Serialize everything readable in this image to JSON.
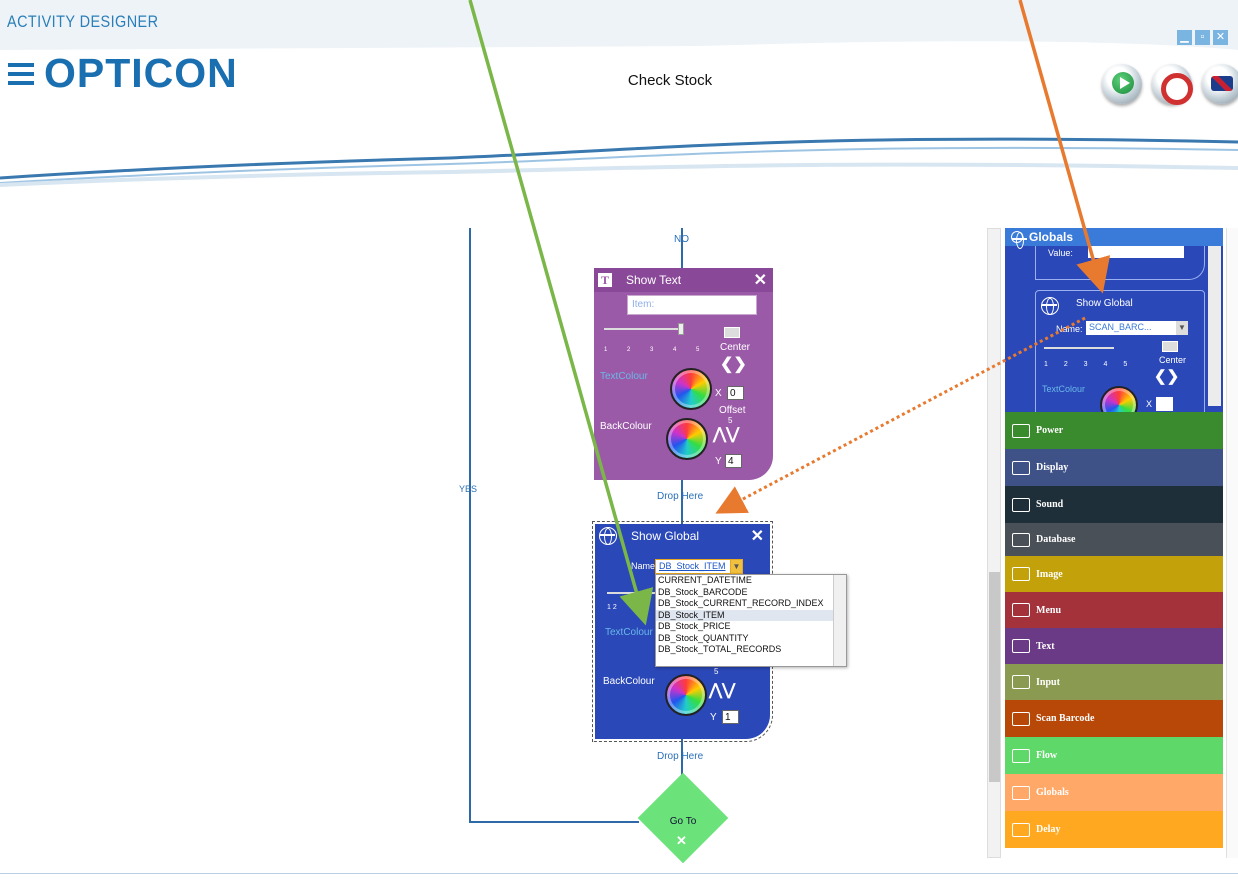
{
  "app": {
    "title": "ACTIVITY DESIGNER",
    "brand": "OPTICON"
  },
  "page": {
    "title": "Check Stock"
  },
  "window_controls": {
    "minimize": "▁",
    "restore": "▫",
    "close": "✕"
  },
  "flow": {
    "no_label": "NO",
    "yes_label": "YES",
    "drop_here_1": "Drop Here",
    "drop_here_2": "Drop Here"
  },
  "show_text": {
    "title": "Show Text",
    "item_placeholder": "Item:",
    "ticks": "1 2 3 4 5",
    "center": "Center",
    "text_colour": "TextColour",
    "back_colour": "BackColour",
    "x_label": "X",
    "x_value": "0",
    "offset_label": "Offset",
    "offset_value": "5",
    "y_label": "Y",
    "y_value": "4"
  },
  "show_global": {
    "title": "Show Global",
    "name_label": "Name:",
    "name_value": "DB_Stock_ITEM",
    "text_colour": "TextColour",
    "back_colour": "BackColour",
    "offset_value": "5",
    "y_label": "Y",
    "y_value": "1",
    "options": [
      "CURRENT_DATETIME",
      "DB_Stock_BARCODE",
      "DB_Stock_CURRENT_RECORD_INDEX",
      "DB_Stock_ITEM",
      "DB_Stock_PRICE",
      "DB_Stock_QUANTITY",
      "DB_Stock_TOTAL_RECORDS"
    ],
    "selected_index": 3
  },
  "goto": {
    "label": "Go To",
    "close": "✕"
  },
  "toolbox": {
    "globals_header": "Globals",
    "value_label": "Value:",
    "inner_title": "Show Global",
    "inner_name_label": "Name:",
    "inner_name_value": "SCAN_BARC...",
    "inner_ticks": "1 2 3 4 5",
    "inner_center": "Center",
    "inner_text_colour": "TextColour",
    "inner_x": "X",
    "categories": [
      {
        "label": "Power",
        "color": "#3a8a2e"
      },
      {
        "label": "Display",
        "color": "#3f5287"
      },
      {
        "label": "Sound",
        "color": "#1f2f3a"
      },
      {
        "label": "Database",
        "color": "#4a5058"
      },
      {
        "label": "Image",
        "color": "#c2a10a"
      },
      {
        "label": "Menu",
        "color": "#a3323a"
      },
      {
        "label": "Text",
        "color": "#6a3a86"
      },
      {
        "label": "Input",
        "color": "#8a9a50"
      },
      {
        "label": "Scan Barcode",
        "color": "#b84808"
      },
      {
        "label": "Flow",
        "color": "#5fd86a"
      },
      {
        "label": "Globals",
        "color": "#ffa868"
      },
      {
        "label": "Delay",
        "color": "#ffa820"
      }
    ]
  },
  "colors": {
    "brand": "#1a6fb0",
    "green_arrow": "#7ab648",
    "orange_arrow": "#e87a30"
  }
}
